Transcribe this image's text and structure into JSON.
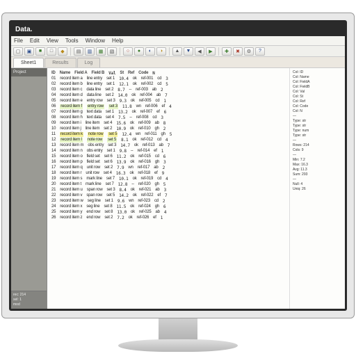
{
  "title": "Data.",
  "menu": [
    "File",
    "Edit",
    "View",
    "Tools",
    "Window",
    "Help"
  ],
  "toolbar": [
    {
      "ic": "▢",
      "c": ""
    },
    {
      "ic": "▣",
      "c": "b"
    },
    {
      "ic": "■",
      "c": "g"
    },
    {
      "ic": "□",
      "c": ""
    },
    {
      "ic": "◆",
      "c": "y"
    },
    {
      "sep": 1
    },
    {
      "ic": "▤",
      "c": ""
    },
    {
      "ic": "▥",
      "c": "b"
    },
    {
      "ic": "▦",
      "c": "g"
    },
    {
      "ic": "▧",
      "c": ""
    },
    {
      "sep": 1
    },
    {
      "ic": "○",
      "c": "r"
    },
    {
      "ic": "●",
      "c": "g"
    },
    {
      "ic": "◐",
      "c": "b"
    },
    {
      "ic": "◑",
      "c": "y"
    },
    {
      "sep": 1
    },
    {
      "ic": "▲",
      "c": ""
    },
    {
      "ic": "▼",
      "c": "b"
    },
    {
      "ic": "◀",
      "c": ""
    },
    {
      "ic": "▶",
      "c": "g"
    },
    {
      "sep": 1
    },
    {
      "ic": "✚",
      "c": "g"
    },
    {
      "ic": "✖",
      "c": "r"
    },
    {
      "ic": "⚙",
      "c": ""
    },
    {
      "ic": "?",
      "c": "b"
    }
  ],
  "tabs": [
    {
      "label": "Sheet1",
      "active": true
    },
    {
      "label": "Results",
      "active": false
    },
    {
      "label": "Log",
      "active": false
    }
  ],
  "sidebar": {
    "header": "Project",
    "footer": [
      "rec: 214",
      "sel: 1",
      "mod"
    ]
  },
  "rows": [
    [
      "ID",
      "Name",
      "Field A",
      "Field B",
      "Val",
      "St",
      "Ref",
      "Code",
      "N"
    ],
    [
      "01",
      "record item a",
      "line entry",
      "set 1",
      "10.4",
      "ok",
      "ref-001",
      "cd",
      "3"
    ],
    [
      "02",
      "record item b",
      "line entry",
      "set 1",
      "12.1",
      "ok",
      "ref-002",
      "cd",
      "5"
    ],
    [
      "03",
      "record item c",
      "data line",
      "set 2",
      "8.7",
      "--",
      "ref-003",
      "ab",
      "2"
    ],
    [
      "04",
      "record item d",
      "data line",
      "set 2",
      "14.0",
      "ok",
      "ref-004",
      "ab",
      "7"
    ],
    [
      "05",
      "record item e",
      "entry row",
      "set 3",
      "9.3",
      "ok",
      "ref-005",
      "cd",
      "1"
    ],
    [
      "06",
      "record item f",
      "entry row",
      "set 3",
      "11.8",
      "wn",
      "ref-006",
      "ef",
      "4"
    ],
    [
      "07",
      "record item g",
      "text data",
      "set 1",
      "13.2",
      "ok",
      "ref-007",
      "ef",
      "6"
    ],
    [
      "08",
      "record item h",
      "text data",
      "set 4",
      "7.5",
      "--",
      "ref-008",
      "cd",
      "3"
    ],
    [
      "09",
      "record item i",
      "line item",
      "set 4",
      "15.6",
      "ok",
      "ref-009",
      "ab",
      "8"
    ],
    [
      "10",
      "record item j",
      "line item",
      "set 2",
      "10.9",
      "ok",
      "ref-010",
      "gh",
      "2"
    ],
    [
      "11",
      "record item k",
      "note row",
      "set 5",
      "12.4",
      "wn",
      "ref-011",
      "gh",
      "5"
    ],
    [
      "12",
      "record item l",
      "note row",
      "set 5",
      "8.1",
      "ok",
      "ref-012",
      "cd",
      "4"
    ],
    [
      "13",
      "record item m",
      "obs entry",
      "set 3",
      "14.7",
      "ok",
      "ref-013",
      "ab",
      "7"
    ],
    [
      "14",
      "record item n",
      "obs entry",
      "set 1",
      "9.8",
      "--",
      "ref-014",
      "ef",
      "1"
    ],
    [
      "15",
      "record item o",
      "field set",
      "set 6",
      "11.2",
      "ok",
      "ref-015",
      "cd",
      "6"
    ],
    [
      "16",
      "record item p",
      "field set",
      "set 6",
      "13.9",
      "ok",
      "ref-016",
      "gh",
      "3"
    ],
    [
      "17",
      "record item q",
      "unit row",
      "set 2",
      "7.9",
      "wn",
      "ref-017",
      "ab",
      "2"
    ],
    [
      "18",
      "record item r",
      "unit row",
      "set 4",
      "16.3",
      "ok",
      "ref-018",
      "ef",
      "9"
    ],
    [
      "19",
      "record item s",
      "mark line",
      "set 7",
      "10.1",
      "ok",
      "ref-019",
      "cd",
      "4"
    ],
    [
      "20",
      "record item t",
      "mark line",
      "set 7",
      "12.8",
      "--",
      "ref-020",
      "gh",
      "5"
    ],
    [
      "21",
      "record item u",
      "span row",
      "set 3",
      "8.4",
      "ok",
      "ref-021",
      "ab",
      "3"
    ],
    [
      "22",
      "record item v",
      "span row",
      "set 5",
      "14.2",
      "ok",
      "ref-022",
      "ef",
      "7"
    ],
    [
      "23",
      "record item w",
      "seg line",
      "set 1",
      "9.6",
      "wn",
      "ref-023",
      "cd",
      "2"
    ],
    [
      "24",
      "record item x",
      "seg line",
      "set 8",
      "11.5",
      "ok",
      "ref-024",
      "gh",
      "6"
    ],
    [
      "25",
      "record item y",
      "end row",
      "set 8",
      "13.0",
      "ok",
      "ref-025",
      "ab",
      "4"
    ],
    [
      "26",
      "record item z",
      "end row",
      "set 2",
      "7.2",
      "ok",
      "ref-026",
      "ef",
      "1"
    ]
  ],
  "hl_rows": [
    6,
    11,
    12
  ],
  "rpanel": [
    "Col: ID",
    "Col: Name",
    "Col: FieldA",
    "Col: FieldB",
    "Col: Val",
    "Col: St",
    "Col: Ref",
    "Col: Code",
    "Col: N",
    "—",
    "Type: str",
    "Type: str",
    "Type: num",
    "Type: str",
    "—",
    "Rows: 214",
    "Cols: 9",
    "—",
    "Min: 7.2",
    "Max: 16.3",
    "Avg: 11.3",
    "Sum: 293",
    "—",
    "Null: 4",
    "Uniq: 26"
  ]
}
